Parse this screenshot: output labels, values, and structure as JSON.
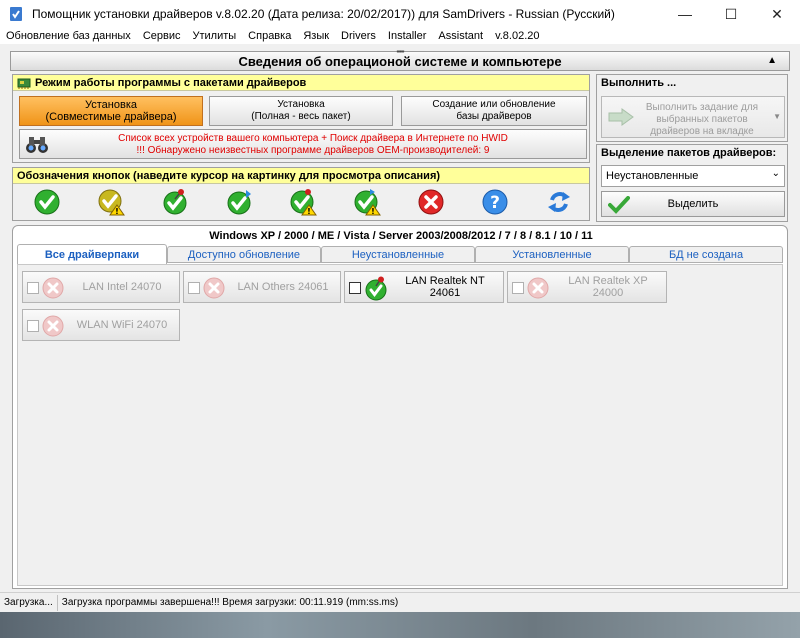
{
  "window": {
    "title": "Помощник установки драйверов v.8.02.20 (Дата релиза: 20/02/2017)) для SamDrivers - Russian (Русский)",
    "minimize": "—",
    "maximize": "☐",
    "close": "✕"
  },
  "menu": [
    "Обновление баз данных",
    "Сервис",
    "Утилиты",
    "Справка",
    "Язык",
    "Drivers",
    "Installer",
    "Assistant",
    "v.8.02.20"
  ],
  "header": {
    "grip": "''''''''''",
    "title": "Сведения об операционой системе и компьютере",
    "caret": "▲"
  },
  "mode_panel": {
    "title": "Режим работы программы с пакетами драйверов",
    "buttons": [
      {
        "line1": "Установка",
        "line2": "(Совместимые драйвера)",
        "active": true
      },
      {
        "line1": "Установка",
        "line2": "(Полная - весь пакет)",
        "active": false
      },
      {
        "line1": "Создание или обновление",
        "line2": "базы драйверов",
        "active": false
      }
    ],
    "info_line1": "Список всех устройств вашего компьютера + Поиск драйвера в Интернете по HWID",
    "info_line2": "!!! Обнаружено неизвестных программе драйверов OEM-производителей: 9"
  },
  "legend_panel": {
    "title": "Обозначения кнопок (наведите курсор на картинку для просмотра описания)",
    "icons": [
      "check-icon",
      "check-warning-icon",
      "check-pin-icon",
      "check-arrow-icon",
      "check-pin-warning-icon",
      "check-pin-warning-alt-icon",
      "error-icon",
      "help-icon",
      "refresh-icon"
    ]
  },
  "exec_panel": {
    "title": "Выполнить ...",
    "button_line1": "Выполнить задание для",
    "button_line2": "выбранных пакетов",
    "button_line3": "драйверов на вкладке",
    "dropdown": "▼"
  },
  "select_panel": {
    "title": "Выделение пакетов драйверов:",
    "combo_value": "Неустановленные",
    "combo_chev": "⌄",
    "button": "Выделить"
  },
  "os_info": "Windows XP / 2000 / ME / Vista / Server 2003/2008/2012 / 7 / 8 / 8.1 / 10 / 11",
  "tabs": [
    "Все драйверпаки",
    "Доступно обновление",
    "Неустановленные",
    "Установленные",
    "БД не создана"
  ],
  "drivers": [
    {
      "line1": "LAN Intel 24070",
      "line2": "",
      "enabled": false
    },
    {
      "line1": "LAN Others 24061",
      "line2": "",
      "enabled": false
    },
    {
      "line1": "LAN Realtek NT",
      "line2": "24061",
      "enabled": true
    },
    {
      "line1": "LAN Realtek XP",
      "line2": "24000",
      "enabled": false
    },
    {
      "line1": "WLAN WiFi 24070",
      "line2": "",
      "enabled": false
    }
  ],
  "status": {
    "left": "Загрузка...",
    "message": "Загрузка программы завершена!!! Время загрузки: 00:11.919 (mm:ss.ms)"
  },
  "colors": {
    "accent_orange": "#f09418",
    "legend_yellow": "#ffff9a",
    "warning_red": "#e00000",
    "tab_blue": "#1c60c0"
  }
}
